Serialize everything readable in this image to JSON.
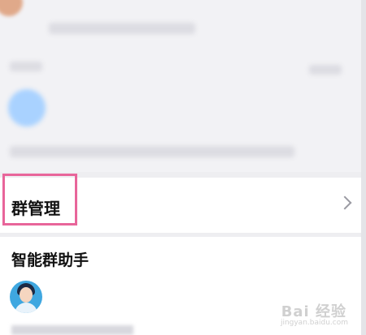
{
  "group_management": {
    "label": "群管理"
  },
  "smart_assistant": {
    "title": "智能群助手"
  },
  "watermark": {
    "text": "Bai 经验",
    "sub": "jingyan.baidu.com"
  }
}
